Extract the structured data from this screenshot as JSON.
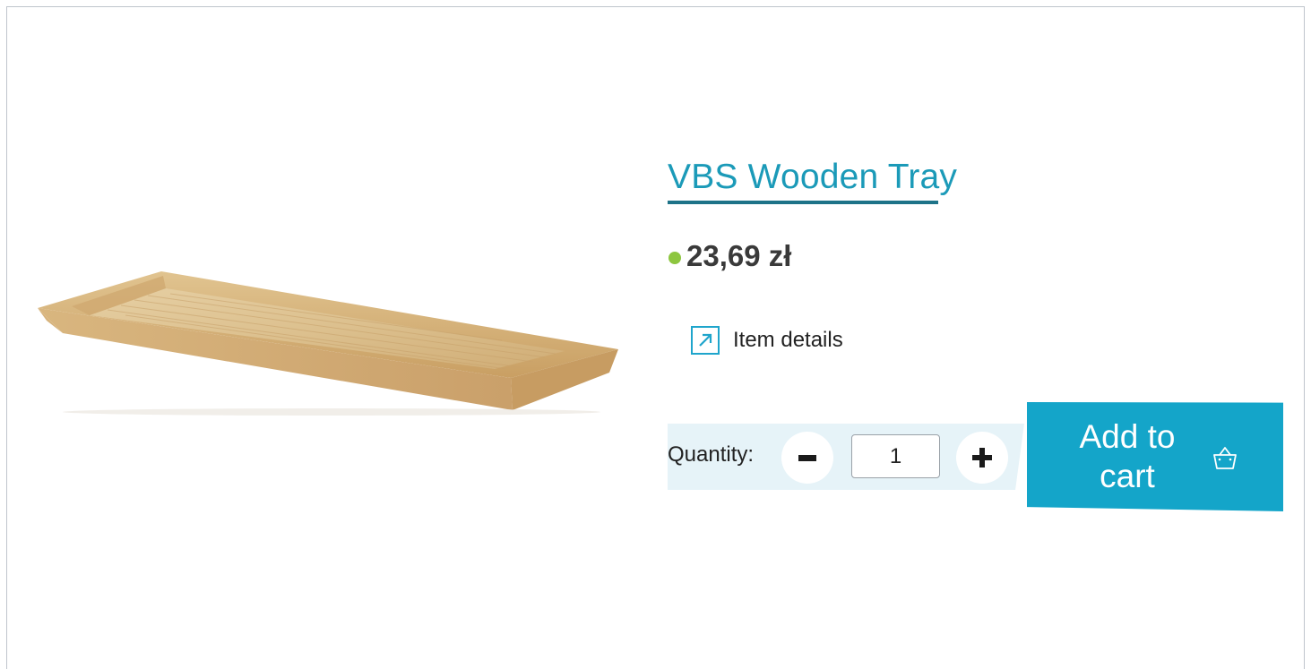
{
  "product": {
    "title": "VBS Wooden Tray",
    "price": "23,69 zł",
    "availability_color": "#8dc63f",
    "image_alt": "wooden tray"
  },
  "details": {
    "label": "Item details",
    "icon": "external-link-arrow-icon"
  },
  "quantity": {
    "label": "Quantity:",
    "value": "1",
    "decrease_icon": "minus-icon",
    "increase_icon": "plus-icon"
  },
  "cart": {
    "label": "Add to cart",
    "icon": "basket-icon",
    "color": "#14a5c9"
  },
  "colors": {
    "accent": "#1b9ab8",
    "price_text": "#3a3a3a",
    "qty_panel": "#e6f3f8"
  }
}
